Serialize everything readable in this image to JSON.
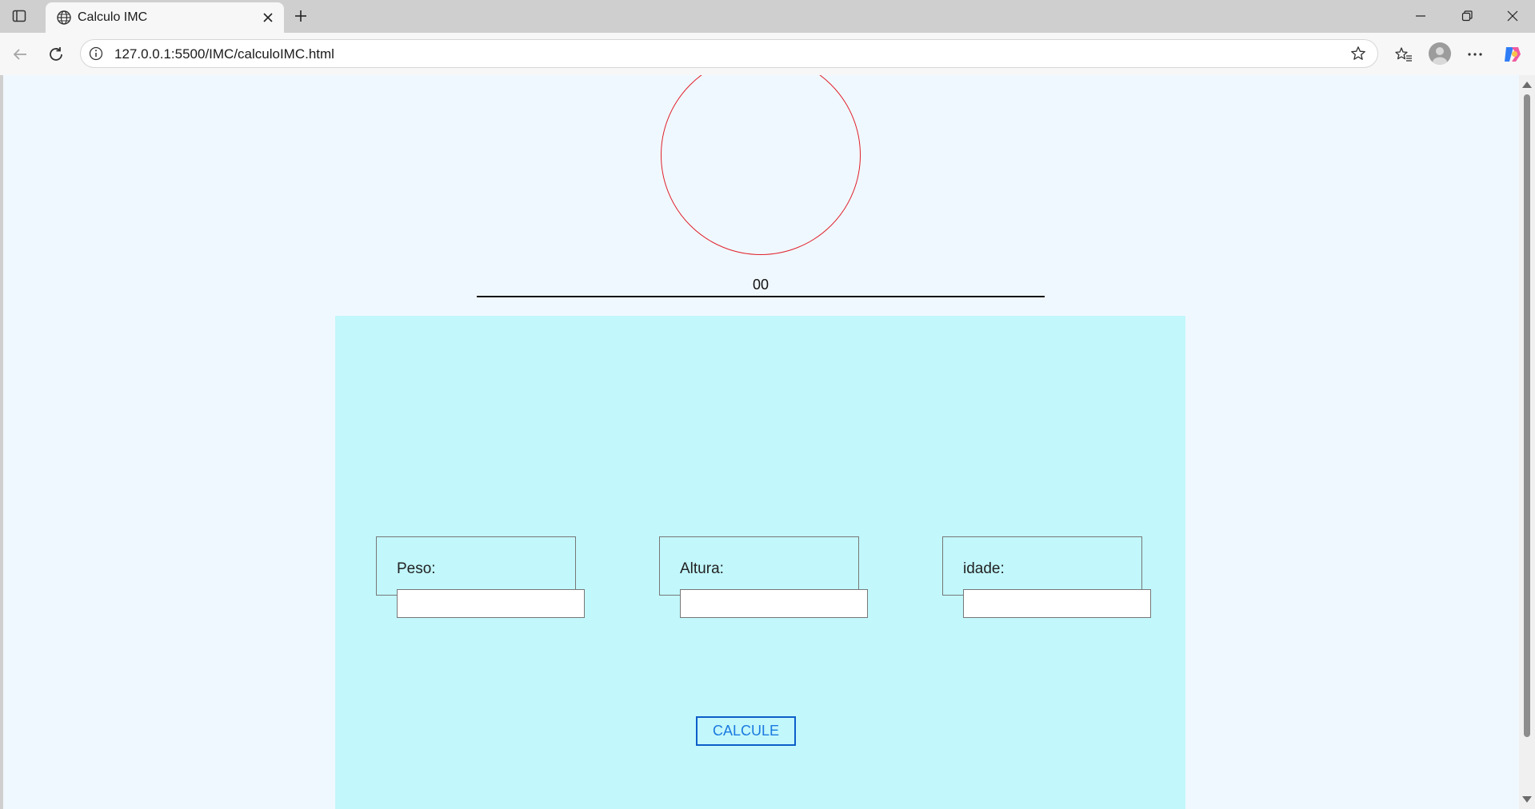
{
  "browser": {
    "tab": {
      "title": "Calculo IMC"
    },
    "address_bar": {
      "url": "127.0.0.1:5500/IMC/calculoIMC.html"
    },
    "icons": [
      "sidebar-icon",
      "globe-icon",
      "close-icon",
      "plus-icon",
      "minimize-icon",
      "restore-icon",
      "window-close-icon",
      "back-icon",
      "reload-icon",
      "info-icon",
      "star-icon",
      "favorites-icon",
      "profile-icon",
      "more-icon",
      "copilot-icon"
    ]
  },
  "page": {
    "result_value": "00",
    "fields": [
      {
        "label": "Peso:",
        "value": ""
      },
      {
        "label": "Altura:",
        "value": ""
      },
      {
        "label": "idade:",
        "value": ""
      }
    ],
    "button_label": "CALCULE",
    "colors": {
      "page_background": "#f0f8ff",
      "panel_background": "#c2f7fb",
      "circle_border": "#e0202a",
      "button_border": "#0b5ec9",
      "button_text": "#1a7ae0"
    }
  }
}
